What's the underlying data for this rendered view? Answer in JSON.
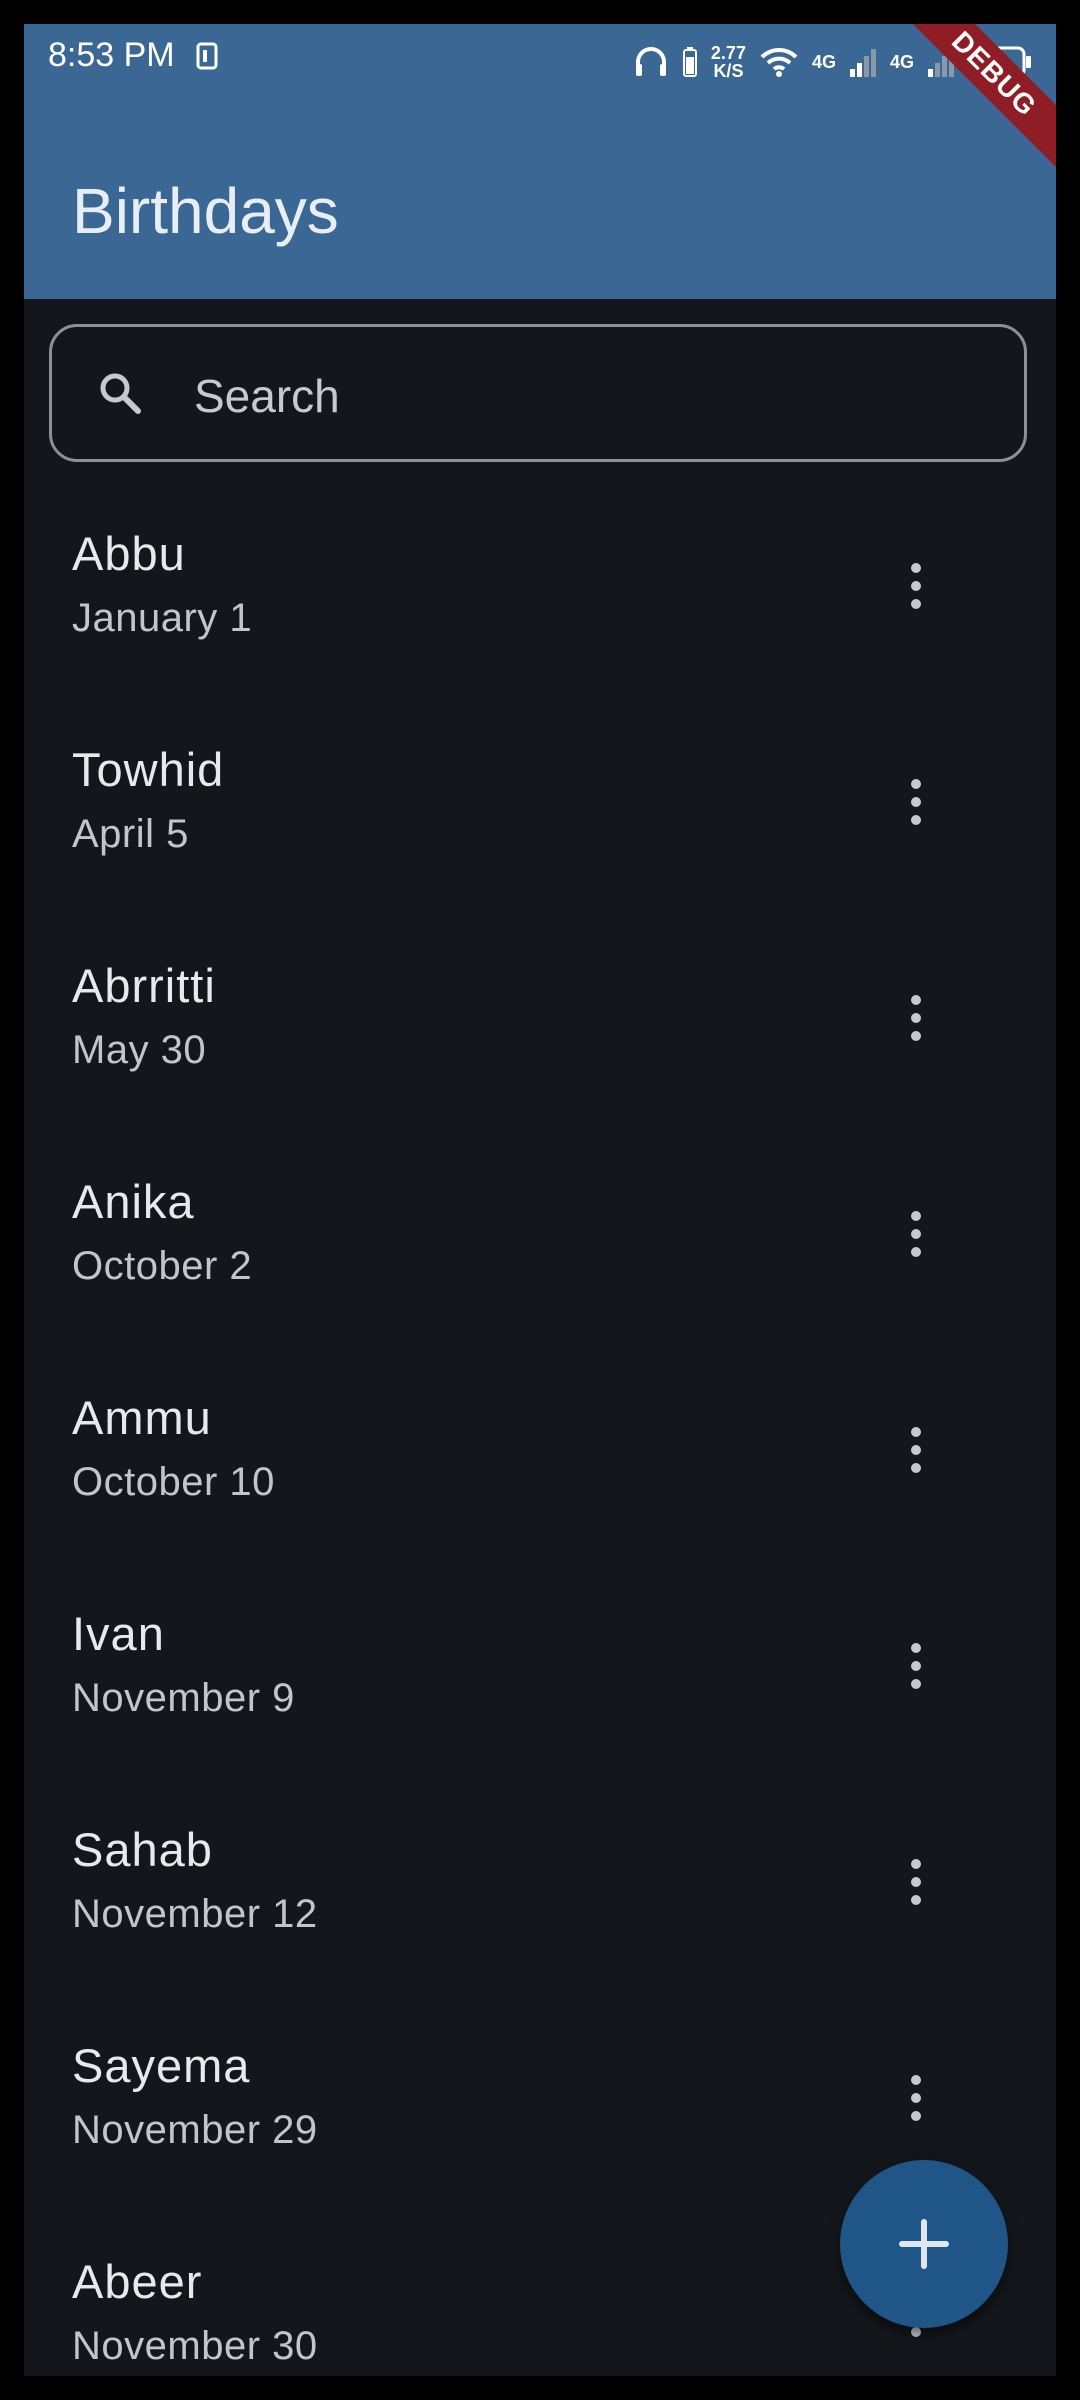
{
  "status_bar": {
    "time": "8:53 PM",
    "speed_value": "2.77",
    "speed_unit": "K/S",
    "network_1": "4G",
    "network_2": "4G",
    "debug_label": "DEBUG"
  },
  "app_bar": {
    "title": "Birthdays"
  },
  "search": {
    "placeholder": "Search"
  },
  "contacts": [
    {
      "name": "Abbu",
      "date": "January 1"
    },
    {
      "name": "Towhid",
      "date": "April 5"
    },
    {
      "name": "Abrritti",
      "date": "May 30"
    },
    {
      "name": "Anika",
      "date": "October 2"
    },
    {
      "name": "Ammu",
      "date": "October 10"
    },
    {
      "name": "Ivan",
      "date": "November 9"
    },
    {
      "name": "Sahab",
      "date": "November 12"
    },
    {
      "name": "Sayema",
      "date": "November 29"
    },
    {
      "name": "Abeer",
      "date": "November 30"
    }
  ],
  "icons": {
    "search": "search-icon",
    "more": "more-vert-icon",
    "add": "add-icon"
  },
  "colors": {
    "app_bar": "#3a6794",
    "background": "#13161b",
    "fab": "#1f5587",
    "debug_banner": "#8e1d26"
  }
}
